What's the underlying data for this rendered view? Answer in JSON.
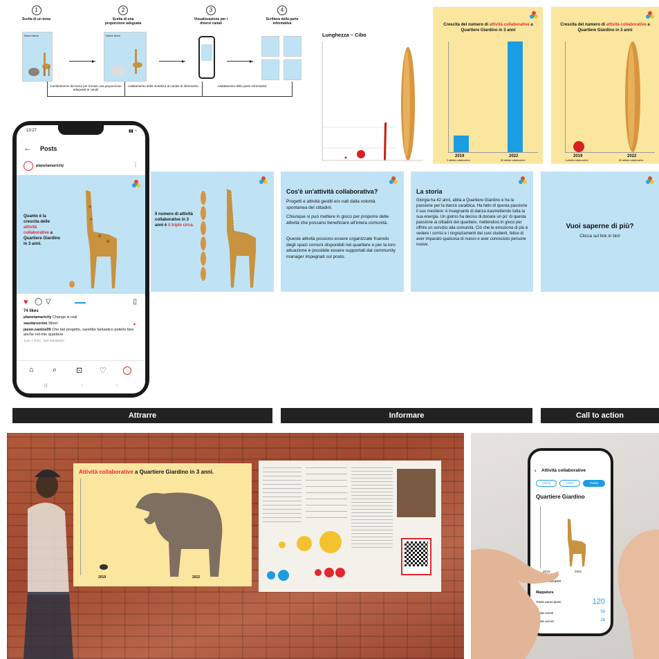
{
  "flow": {
    "steps": [
      {
        "num": "1",
        "caption": "Scelta di un tema"
      },
      {
        "num": "2",
        "caption": "Scelta di una proporzione adeguata"
      },
      {
        "num": "3",
        "caption": "Visualizzazione per i diversi canali"
      },
      {
        "num": "4",
        "caption": "Scrittura della parte informativa"
      }
    ],
    "thumb_label": "Nome tema",
    "feedback": [
      "Cambiamento del tema per trovare una proporzione adeguata ai canali",
      "Adattamento della metafora al canale di riferimento",
      "Adattamento della parte informativa"
    ]
  },
  "chart_small": {
    "title": "Lunghezza – Cibo"
  },
  "card_a": {
    "title_pre": "Crescita del numero di",
    "title_hl": "attività collaborative",
    "title_post": "a Quartiere Giardino in 3 anni",
    "year1": "2019",
    "year2": "2022",
    "sub1": "3 attività collaborative",
    "sub2": "80 attività collaborative"
  },
  "card_b": {
    "title_pre": "Crescita del numero di",
    "title_hl": "attività collaborative",
    "title_post": "a Quartiere Giardino in 3 anni",
    "year1": "2019",
    "year2": "2022",
    "sub1": "3 attività collaborative",
    "sub2": "80 attività collaborative"
  },
  "phone": {
    "time": "13:27",
    "header": "Posts",
    "account": "planetamaricity",
    "post_text_1": "Quanto è la crescita delle",
    "post_text_hl": "attività collaborative",
    "post_text_2": "a Quartiere Giardino in 3 anni.",
    "likes": "74 likes",
    "caption_user": "planetamaricity",
    "caption_text": "Change is real",
    "comment1_user": "saudarsorme",
    "comment1_text": "Wow!",
    "comment2_user": "jason.santos00",
    "comment2_text": "Che bel progetto, sarebbe fantastico poterlo fare anche nel mio quartiere",
    "time_ago": "June 1 2022",
    "see_translation": "See translation"
  },
  "carousel": {
    "slide2_text_1": "Il numero di attività collaborative in 3 anni è",
    "slide2_text_hl": "il triplo circa.",
    "slide3_title": "Cos'è un'attività collaborativa?",
    "slide3_p1": "Progetti e attività gestiti e/o nati dalla volontà spontanea dei cittadini.",
    "slide3_p2": "Chiunque si può mettere in gioco per proporre delle attività che possano beneficiare all'intera comunità.",
    "slide3_p3": "Queste attività possono essere organizzate fruendo degli spazi comuni disponibili nel quartiere e per la loro attuazione è possibile essere supportati dal community manager impegnati sul posto.",
    "slide4_title": "La storia",
    "slide4_p": "Giorgia ha 42 anni, abita a Quartiere Giardino e ha la passione per la danza caraibica. Ha fatto di questa passione il suo mestiere: è insegnante di danza trasmettendo tutta la sua energia. Un giorno ha deciso di donare un po' di questa passione ai cittadini del quartiere, mettendosi in gioco per offrire un servizio alla comunità. Ciò che le emoziona di più è vedere i sorrisi e i ringraziamenti dei suoi studenti, felice di aver imparato qualcosa di nuovo e aver conosciuto persone nuove.",
    "slide5_title": "Vuoi saperne di più?",
    "slide5_sub": "Clicca sul link in bio!"
  },
  "labels": {
    "attract": "Attrarre",
    "inform": "Informare",
    "cta": "Call to action"
  },
  "poster": {
    "title_hl": "Attività collaborative",
    "title_post": "a Quartiere Giardino in 3 anni.",
    "year1": "2019",
    "year2": "2022"
  },
  "app": {
    "title": "Attività collaborative",
    "tab1": "Cerca",
    "tab2": "Crea",
    "tab3": "Guida",
    "heading": "Quartiere Giardino",
    "year1": "2019",
    "year2": "2022",
    "section": "Indicatori",
    "row1": "Mappatura",
    "row2": "Totale partecipanti",
    "row2_val": "120",
    "row3": "Totale eventi",
    "row3_val": "58",
    "row4": "Totale servizi",
    "row4_val": "26"
  },
  "colors": {
    "accent": "#e5262d",
    "sky": "#bfe3f5",
    "sand": "#fbe6a0",
    "bar_blue": "#1b9de2",
    "label_bar": "#222222"
  },
  "icons": [
    "back-arrow-icon",
    "more-icon",
    "heart-icon",
    "comment-icon",
    "share-icon",
    "bookmark-icon",
    "home-icon",
    "search-icon",
    "reels-icon",
    "activity-icon",
    "profile-icon",
    "multicolor-logo-icon",
    "qr-code-icon"
  ]
}
